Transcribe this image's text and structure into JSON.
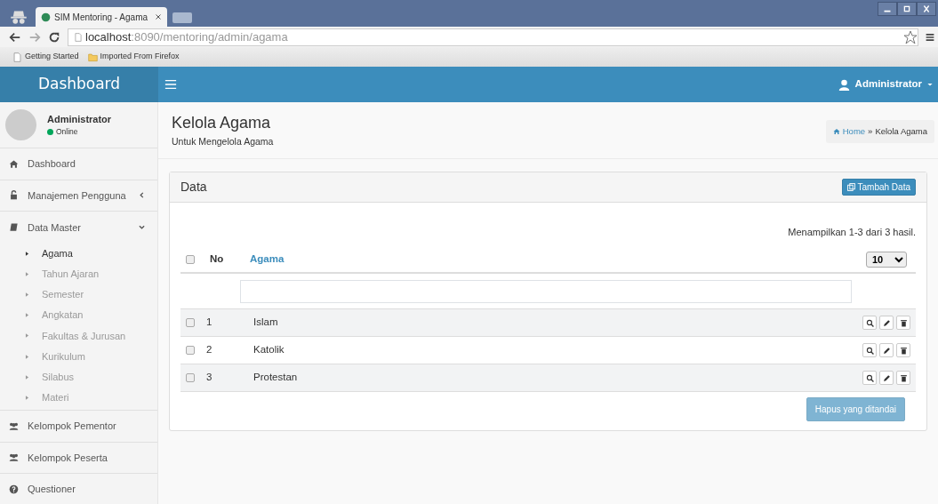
{
  "browser": {
    "tab_title": "SIM Mentoring - Agama",
    "address_host": "localhost",
    "address_path": ":8090/mentoring/admin/agama",
    "bookmarks": [
      {
        "label": "Getting Started",
        "kind": "page"
      },
      {
        "label": "Imported From Firefox",
        "kind": "folder"
      }
    ]
  },
  "header": {
    "brand": "Dashboard",
    "user": "Administrator"
  },
  "sidebar": {
    "user": {
      "name": "Administrator",
      "status": "Online"
    },
    "menu": [
      {
        "label": "Dashboard"
      },
      {
        "label": "Manajemen Pengguna",
        "expanded": false
      },
      {
        "label": "Data Master",
        "expanded": true,
        "children": [
          {
            "label": "Agama",
            "selected": true
          },
          {
            "label": "Tahun Ajaran",
            "selected": false
          },
          {
            "label": "Semester",
            "selected": false
          },
          {
            "label": "Angkatan",
            "selected": false
          },
          {
            "label": "Fakultas & Jurusan",
            "selected": false
          },
          {
            "label": "Kurikulum",
            "selected": false
          },
          {
            "label": "Silabus",
            "selected": false
          },
          {
            "label": "Materi",
            "selected": false
          }
        ]
      },
      {
        "label": "Kelompok Pementor"
      },
      {
        "label": "Kelompok Peserta"
      },
      {
        "label": "Questioner"
      }
    ]
  },
  "page": {
    "title": "Kelola Agama",
    "subtitle": "Untuk Mengelola Agama",
    "breadcrumb": [
      "Home",
      "Kelola Agama"
    ],
    "breadcrumb_separator": "»"
  },
  "panel": {
    "title": "Data",
    "add_button": "Tambah Data",
    "summary": "Menampilkan 1-3 dari 3 hasil.",
    "select_all_checked": false,
    "columns": [
      "No",
      "Agama"
    ],
    "page_size": "10",
    "rows": [
      {
        "no": "1",
        "agama": "Islam",
        "checked": false
      },
      {
        "no": "2",
        "agama": "Katolik",
        "checked": false
      },
      {
        "no": "3",
        "agama": "Protestan",
        "checked": false
      }
    ],
    "delete_button": {
      "label": "Hapus yang ditandai",
      "disabled": true
    }
  }
}
